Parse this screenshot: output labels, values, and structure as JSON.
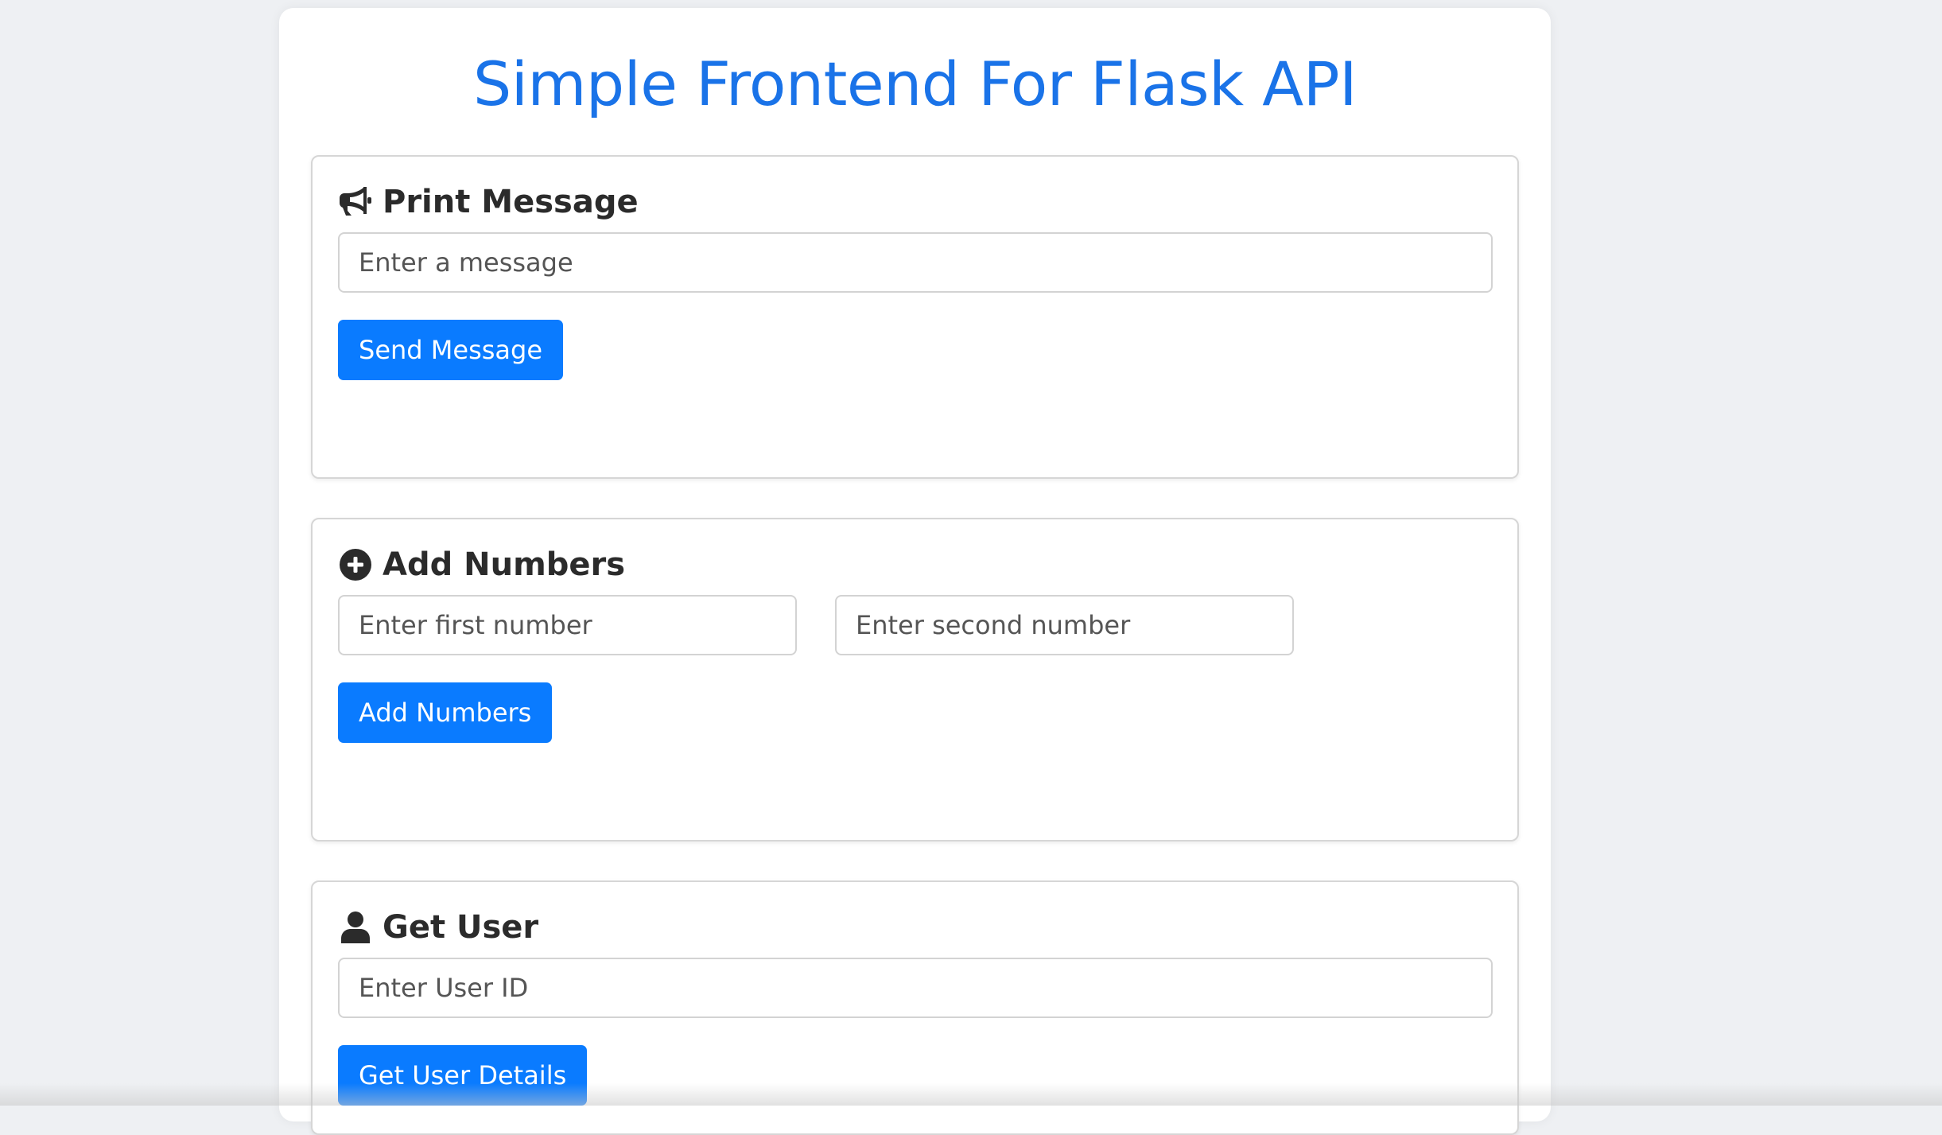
{
  "page": {
    "title": "Simple Frontend For Flask API"
  },
  "print_message": {
    "title": "Print Message",
    "icon": "megaphone-icon",
    "input_placeholder": "Enter a message",
    "input_value": "",
    "button_label": "Send Message"
  },
  "add_numbers": {
    "title": "Add Numbers",
    "icon": "plus-circle-icon",
    "first_placeholder": "Enter first number",
    "first_value": "",
    "second_placeholder": "Enter second number",
    "second_value": "",
    "button_label": "Add Numbers"
  },
  "get_user": {
    "title": "Get User",
    "icon": "user-icon",
    "input_placeholder": "Enter User ID",
    "input_value": "",
    "button_label": "Get User Details"
  },
  "colors": {
    "accent": "#0a7bff",
    "title": "#1a73e8",
    "background": "#eef0f3",
    "heading_text": "#2b2b2b"
  }
}
